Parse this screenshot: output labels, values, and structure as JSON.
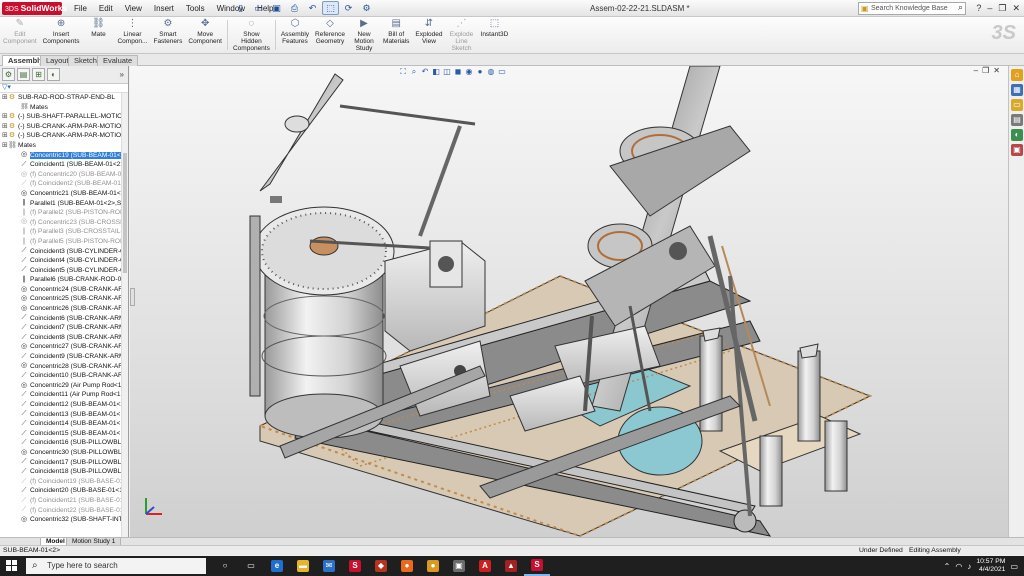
{
  "app": {
    "logo_ds": "3DS",
    "logo_text": "SolidWorks",
    "doc_title": "Assem-02-22-21.SLDASM *"
  },
  "menus": [
    "File",
    "Edit",
    "View",
    "Insert",
    "Tools",
    "Window",
    "Help"
  ],
  "quick_access": [
    "new-icon",
    "open-icon",
    "save-icon",
    "print-icon",
    "undo-icon",
    "select-icon",
    "rebuild-icon",
    "options-icon"
  ],
  "search": {
    "placeholder": "Search Knowledge Base"
  },
  "ribbon": [
    {
      "icon": "edit-component-icon",
      "label": "Edit\nComponent",
      "enabled": false
    },
    {
      "icon": "insert-components-icon",
      "label": "Insert\nComponents",
      "enabled": true
    },
    {
      "icon": "mate-icon",
      "label": "Mate",
      "enabled": true
    },
    {
      "icon": "linear-pattern-icon",
      "label": "Linear\nCompon...",
      "enabled": true
    },
    {
      "icon": "smart-fasteners-icon",
      "label": "Smart\nFasteners",
      "enabled": true
    },
    {
      "icon": "move-component-icon",
      "label": "Move\nComponent",
      "enabled": true
    },
    {
      "icon": "show-hidden-icon",
      "label": "Show\nHidden\nComponents",
      "enabled": true
    },
    {
      "icon": "assembly-features-icon",
      "label": "Assembly\nFeatures",
      "enabled": true
    },
    {
      "icon": "reference-geometry-icon",
      "label": "Reference\nGeometry",
      "enabled": true
    },
    {
      "icon": "new-motion-study-icon",
      "label": "New\nMotion\nStudy",
      "enabled": true
    },
    {
      "icon": "bill-of-materials-icon",
      "label": "Bill of\nMaterials",
      "enabled": true
    },
    {
      "icon": "exploded-view-icon",
      "label": "Exploded\nView",
      "enabled": true
    },
    {
      "icon": "explode-line-sketch-icon",
      "label": "Explode\nLine\nSketch",
      "enabled": false
    },
    {
      "icon": "instant3d-icon",
      "label": "Instant3D",
      "enabled": true
    }
  ],
  "command_tabs": [
    "Assembly",
    "Layout",
    "Sketch",
    "Evaluate"
  ],
  "active_command_tab": "Assembly",
  "tree": [
    {
      "text": "SUB-RAD-ROD-STRAP-END-BL",
      "level": 0,
      "kind": "part",
      "state": "normal"
    },
    {
      "text": "Mates",
      "level": 1,
      "kind": "mates",
      "state": "normal"
    },
    {
      "text": "(-) SUB-SHAFT-PARALLEL-MOTION",
      "level": 0,
      "kind": "part",
      "state": "normal"
    },
    {
      "text": "(-) SUB-CRANK-ARM-PAR-MOTIO",
      "level": 0,
      "kind": "part",
      "state": "normal"
    },
    {
      "text": "(-) SUB-CRANK-ARM-PAR-MOTIO",
      "level": 0,
      "kind": "part",
      "state": "normal"
    },
    {
      "text": "Mates",
      "level": 0,
      "kind": "mates",
      "state": "normal"
    },
    {
      "text": "Concentric19 (SUB-BEAM-01<2>",
      "level": 1,
      "kind": "concentric",
      "state": "selected"
    },
    {
      "text": "Coincident1 (SUB-BEAM-01<2>",
      "level": 1,
      "kind": "coincident",
      "state": "normal"
    },
    {
      "text": "(f) Concentric20 (SUB-BEAM-01",
      "level": 1,
      "kind": "concentric",
      "state": "suppressed"
    },
    {
      "text": "(f) Coincident2 (SUB-BEAM-01<",
      "level": 1,
      "kind": "coincident",
      "state": "suppressed"
    },
    {
      "text": "Concentric21 (SUB-BEAM-01<>",
      "level": 1,
      "kind": "concentric",
      "state": "normal"
    },
    {
      "text": "Parallel1 (SUB-BEAM-01<2>,SU",
      "level": 1,
      "kind": "parallel",
      "state": "normal"
    },
    {
      "text": "(f) Parallel2 (SUB-PISTON-ROD",
      "level": 1,
      "kind": "parallel",
      "state": "suppressed"
    },
    {
      "text": "(f) Concentric23 (SUB-CROSSH",
      "level": 1,
      "kind": "concentric",
      "state": "suppressed"
    },
    {
      "text": "(f) Parallel3 (SUB-CROSSTAIL-0",
      "level": 1,
      "kind": "parallel",
      "state": "suppressed"
    },
    {
      "text": "(f) Parallel5 (SUB-PISTON-ROD",
      "level": 1,
      "kind": "parallel",
      "state": "suppressed"
    },
    {
      "text": "Coincident3 (SUB-CYLINDER-0",
      "level": 1,
      "kind": "coincident",
      "state": "normal"
    },
    {
      "text": "Coincident4 (SUB-CYLINDER-0",
      "level": 1,
      "kind": "coincident",
      "state": "normal"
    },
    {
      "text": "Coincident5 (SUB-CYLINDER-0",
      "level": 1,
      "kind": "coincident",
      "state": "normal"
    },
    {
      "text": "Parallel6 (SUB-CRANK-ROD-01",
      "level": 1,
      "kind": "parallel",
      "state": "normal"
    },
    {
      "text": "Concentric24 (SUB-CRANK-ARM",
      "level": 1,
      "kind": "concentric",
      "state": "normal"
    },
    {
      "text": "Concentric25 (SUB-CRANK-ARM",
      "level": 1,
      "kind": "concentric",
      "state": "normal"
    },
    {
      "text": "Concentric26 (SUB-CRANK-ARM",
      "level": 1,
      "kind": "concentric",
      "state": "normal"
    },
    {
      "text": "Coincident6 (SUB-CRANK-ARM",
      "level": 1,
      "kind": "coincident",
      "state": "normal"
    },
    {
      "text": "Coincident7 (SUB-CRANK-ARM",
      "level": 1,
      "kind": "coincident",
      "state": "normal"
    },
    {
      "text": "Coincident8 (SUB-CRANK-ARM",
      "level": 1,
      "kind": "coincident",
      "state": "normal"
    },
    {
      "text": "Concentric27 (SUB-CRANK-ARM",
      "level": 1,
      "kind": "concentric",
      "state": "normal"
    },
    {
      "text": "Coincident9 (SUB-CRANK-ARM",
      "level": 1,
      "kind": "coincident",
      "state": "normal"
    },
    {
      "text": "Concentric28 (SUB-CRANK-ARM",
      "level": 1,
      "kind": "concentric",
      "state": "normal"
    },
    {
      "text": "Coincident10 (SUB-CRANK-ARM",
      "level": 1,
      "kind": "coincident",
      "state": "normal"
    },
    {
      "text": "Concentric29 (Air Pump Rod<1",
      "level": 1,
      "kind": "concentric",
      "state": "normal"
    },
    {
      "text": "Coincident11 (Air Pump Rod<1",
      "level": 1,
      "kind": "coincident",
      "state": "normal"
    },
    {
      "text": "Coincident12 (SUB-BEAM-01<2",
      "level": 1,
      "kind": "coincident",
      "state": "normal"
    },
    {
      "text": "Coincident13 (SUB-BEAM-01<",
      "level": 1,
      "kind": "coincident",
      "state": "normal"
    },
    {
      "text": "Coincident14 (SUB-BEAM-01<",
      "level": 1,
      "kind": "coincident",
      "state": "normal"
    },
    {
      "text": "Coincident15 (SUB-BEAM-01<",
      "level": 1,
      "kind": "coincident",
      "state": "normal"
    },
    {
      "text": "Coincident16 (SUB-PILLOWBLC",
      "level": 1,
      "kind": "coincident",
      "state": "normal"
    },
    {
      "text": "Concentric30 (SUB-PILLOWBLC",
      "level": 1,
      "kind": "concentric",
      "state": "normal"
    },
    {
      "text": "Coincident17 (SUB-PILLOWBLC",
      "level": 1,
      "kind": "coincident",
      "state": "normal"
    },
    {
      "text": "Coincident18 (SUB-PILLOWBLC",
      "level": 1,
      "kind": "coincident",
      "state": "normal"
    },
    {
      "text": "(f) Coincident19 (SUB-BASE-01",
      "level": 1,
      "kind": "coincident",
      "state": "suppressed"
    },
    {
      "text": "Coincident20 (SUB-BASE-01<1",
      "level": 1,
      "kind": "coincident",
      "state": "normal"
    },
    {
      "text": "(f) Coincident21 (SUB-BASE-01",
      "level": 1,
      "kind": "coincident",
      "state": "suppressed"
    },
    {
      "text": "(f) Coincident22 (SUB-BASE-01",
      "level": 1,
      "kind": "coincident",
      "state": "suppressed"
    },
    {
      "text": "Concentric32 (SUB-SHAFT-INT",
      "level": 1,
      "kind": "concentric",
      "state": "normal"
    }
  ],
  "bottom_tabs": [
    "Model",
    "Motion Study 1"
  ],
  "status": {
    "selection": "SUB-BEAM-01<2>",
    "definition": "Under Defined",
    "mode": "Editing Assembly"
  },
  "taskbar": {
    "search_placeholder": "Type here to search",
    "apps": [
      {
        "icon": "cortana-icon",
        "color": "#1f1f1f"
      },
      {
        "icon": "task-view-icon",
        "color": "#1f1f1f"
      },
      {
        "icon": "edge-icon",
        "color": "#1f6fcf"
      },
      {
        "icon": "file-explorer-icon",
        "color": "#e8b52a"
      },
      {
        "icon": "mail-icon",
        "color": "#2a72c7"
      },
      {
        "icon": "solidworks-icon",
        "color": "#c8102e"
      },
      {
        "icon": "app-red-icon",
        "color": "#b5341f"
      },
      {
        "icon": "firefox-icon",
        "color": "#e86a1a"
      },
      {
        "icon": "app-yellow-icon",
        "color": "#d89a22"
      },
      {
        "icon": "app-gray-icon",
        "color": "#6b6b6b"
      },
      {
        "icon": "acrobat-icon",
        "color": "#cc1f1f"
      },
      {
        "icon": "app-red2-icon",
        "color": "#a52020"
      },
      {
        "icon": "solidworks-active-icon",
        "color": "#c8102e"
      }
    ],
    "time": "10:57 PM",
    "date": "4/4/2021"
  }
}
